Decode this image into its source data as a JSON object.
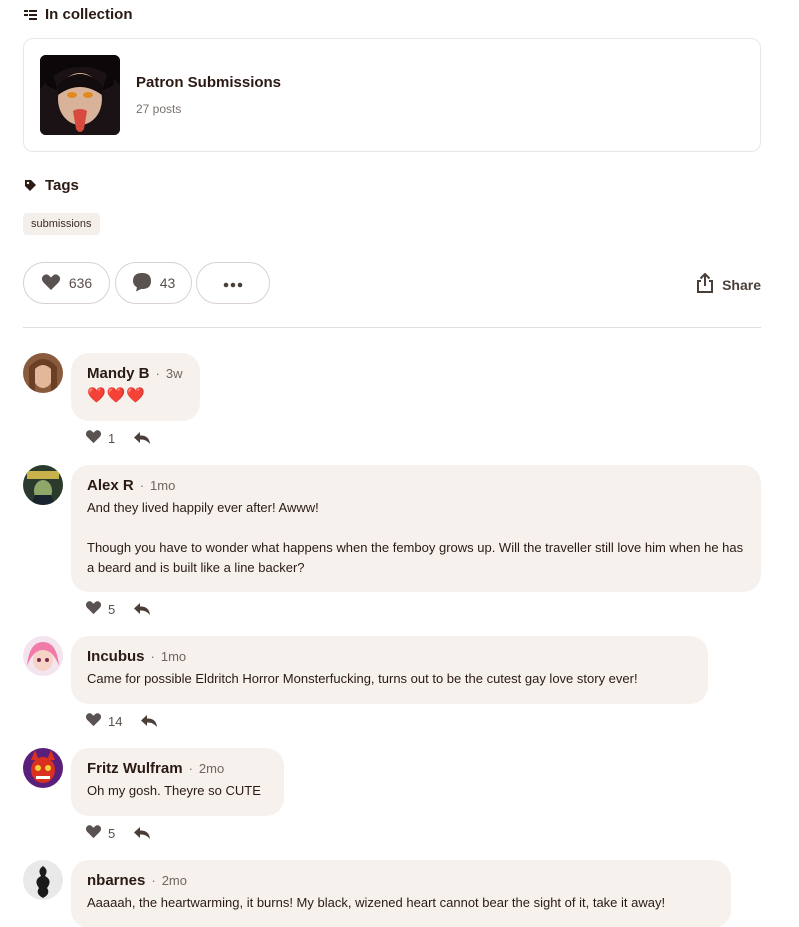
{
  "collection": {
    "heading": "In collection",
    "title": "Patron Submissions",
    "count": "27 posts"
  },
  "tags": {
    "heading": "Tags",
    "items": [
      "submissions"
    ]
  },
  "post_actions": {
    "likes": "636",
    "comments": "43",
    "share_label": "Share"
  },
  "comments": [
    {
      "name": "Mandy B",
      "time": "3w",
      "text": "❤️❤️❤️",
      "likes": "1"
    },
    {
      "name": "Alex R",
      "time": "1mo",
      "text": "And they lived happily ever after!  Awww!\n\nThough you have to wonder what happens when the femboy grows up.  Will the traveller still love him when he has a beard and is built like a line backer?",
      "likes": "5"
    },
    {
      "name": "Incubus",
      "time": "1mo",
      "text": "Came for possible Eldritch Horror Monsterfucking, turns out to be the cutest gay love story ever!",
      "likes": "14"
    },
    {
      "name": "Fritz Wulfram",
      "time": "2mo",
      "text": "Oh my gosh. Theyre so CUTE",
      "likes": "5"
    },
    {
      "name": "nbarnes",
      "time": "2mo",
      "text": "Aaaaah, the heartwarming, it burns! My black, wizened heart cannot bear the sight of it, take it away!",
      "likes": ""
    }
  ],
  "colors": {
    "text": "#2b1a14",
    "bubble": "#f6f1ed",
    "heart_red": "#e02424",
    "icon_gray": "#5a5250"
  }
}
